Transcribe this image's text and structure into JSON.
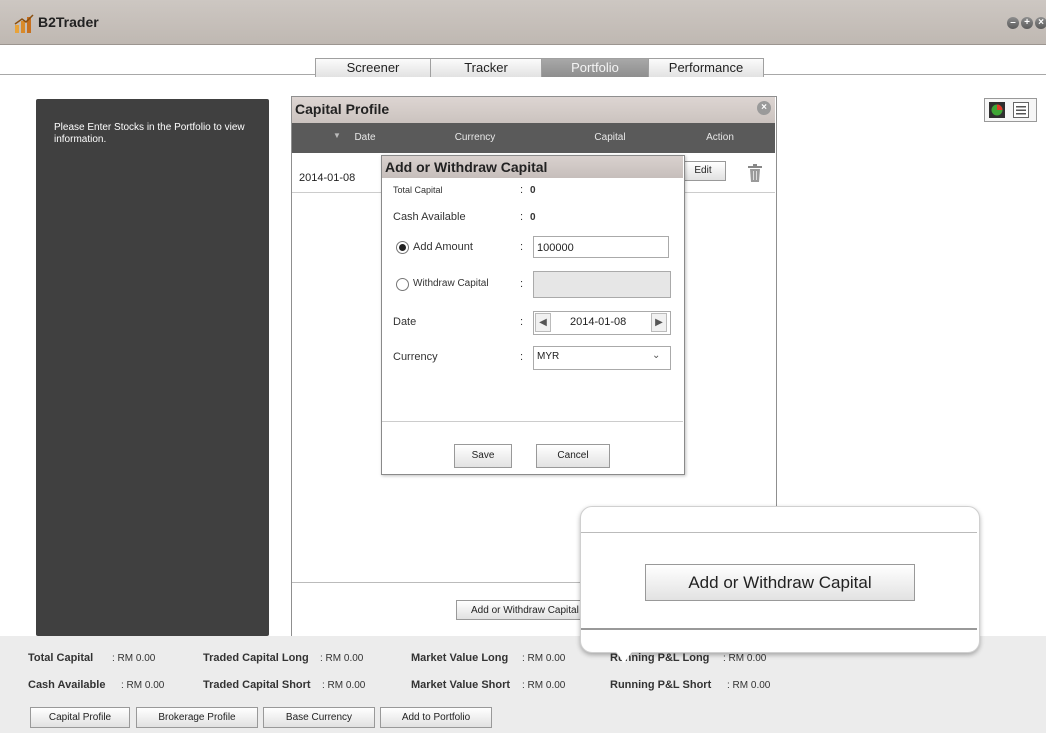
{
  "app": {
    "title": "B2Trader"
  },
  "window_controls": [
    "minimize-icon",
    "maximize-icon",
    "close-icon"
  ],
  "tabs": [
    {
      "label": "Screener",
      "active": false
    },
    {
      "label": "Tracker",
      "active": false
    },
    {
      "label": "Portfolio",
      "active": true
    },
    {
      "label": "Performance",
      "active": false
    }
  ],
  "left_panel": {
    "message": "Please Enter Stocks in the Portfolio to view information."
  },
  "capital_profile": {
    "title": "Capital Profile",
    "columns": [
      "Date",
      "Currency",
      "Capital",
      "Action"
    ],
    "rows": [
      {
        "date": "2014-01-08",
        "action": "Edit"
      }
    ],
    "add_withdraw_button": "Add or Withdraw Capital"
  },
  "dialog": {
    "title": "Add or Withdraw Capital",
    "total_capital_label": "Total Capital",
    "total_capital_value": "0",
    "cash_available_label": "Cash Available",
    "cash_available_value": "0",
    "add_amount_label": "Add Amount",
    "add_amount_value": "100000",
    "withdraw_label": "Withdraw Capital",
    "withdraw_value": "",
    "date_label": "Date",
    "date_value": "2014-01-08",
    "currency_label": "Currency",
    "currency_value": "MYR",
    "save": "Save",
    "cancel": "Cancel",
    "colon": ":"
  },
  "callout": {
    "button": "Add or Withdraw Capital"
  },
  "status": {
    "total_capital_label": "Total Capital",
    "total_capital_value": ": RM 0.00",
    "cash_available_label": "Cash Available",
    "cash_available_value": ": RM 0.00",
    "traded_long_label": "Traded Capital Long",
    "traded_long_value": ": RM 0.00",
    "traded_short_label": "Traded Capital Short",
    "traded_short_value": ": RM 0.00",
    "mv_long_label": "Market Value Long",
    "mv_long_value": ": RM 0.00",
    "mv_short_label": "Market Value Short",
    "mv_short_value": ": RM 0.00",
    "pl_long_label": "Running P&L Long",
    "pl_long_value": ": RM 0.00",
    "pl_short_label": "Running P&L Short",
    "pl_short_value": ": RM 0.00"
  },
  "bottom_buttons": [
    "Capital Profile",
    "Brokerage Profile",
    "Base Currency",
    "Add to Portfolio"
  ],
  "colors": {
    "titlebar": "#c6bfb9",
    "dark_panel": "#404040",
    "active_tab": "#999999",
    "header": "#cbc3bf"
  }
}
